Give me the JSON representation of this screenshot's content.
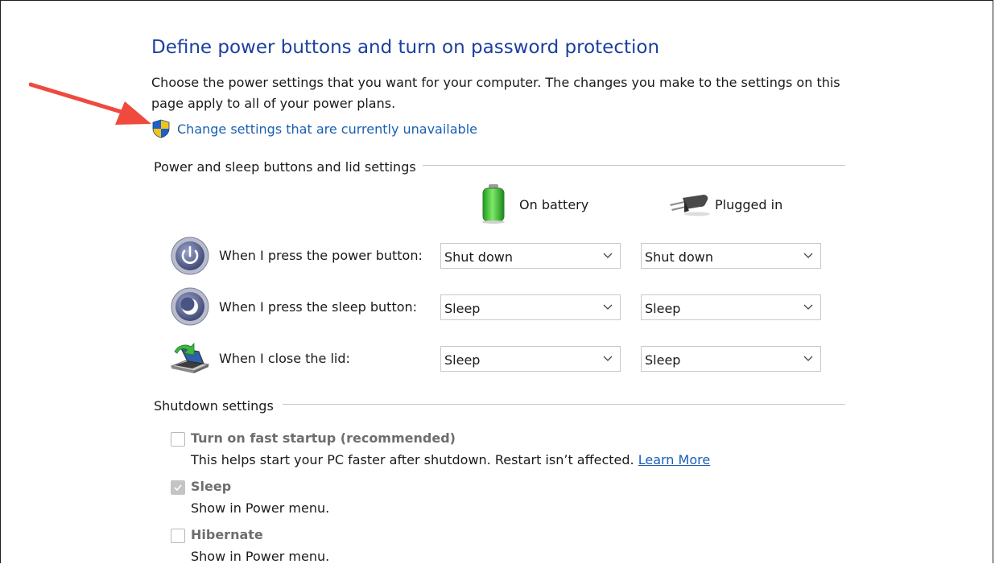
{
  "header": {
    "title": "Define power buttons and turn on password protection",
    "description": "Choose the power settings that you want for your computer. The changes you make to the settings on this page apply to all of your power plans.",
    "change_link": "Change settings that are currently unavailable"
  },
  "power_group": {
    "title": "Power and sleep buttons and lid settings",
    "columns": {
      "battery": "On battery",
      "plugged": "Plugged in"
    },
    "rows": [
      {
        "label": "When I press the power button:",
        "battery": "Shut down",
        "plugged": "Shut down",
        "icon": "power-button-icon"
      },
      {
        "label": "When I press the sleep button:",
        "battery": "Sleep",
        "plugged": "Sleep",
        "icon": "sleep-button-icon"
      },
      {
        "label": "When I close the lid:",
        "battery": "Sleep",
        "plugged": "Sleep",
        "icon": "laptop-lid-icon"
      }
    ]
  },
  "shutdown_group": {
    "title": "Shutdown settings",
    "items": [
      {
        "title": "Turn on fast startup (recommended)",
        "desc": "This helps start your PC faster after shutdown. Restart isn’t affected.",
        "link": "Learn More",
        "checked": false
      },
      {
        "title": "Sleep",
        "desc": "Show in Power menu.",
        "checked": true
      },
      {
        "title": "Hibernate",
        "desc": "Show in Power menu.",
        "checked": false
      }
    ]
  },
  "colors": {
    "title": "#1a3f9e",
    "link": "#1a5fb4",
    "arrow": "#ef4a3d",
    "disabled_text": "#6e6e6e"
  }
}
